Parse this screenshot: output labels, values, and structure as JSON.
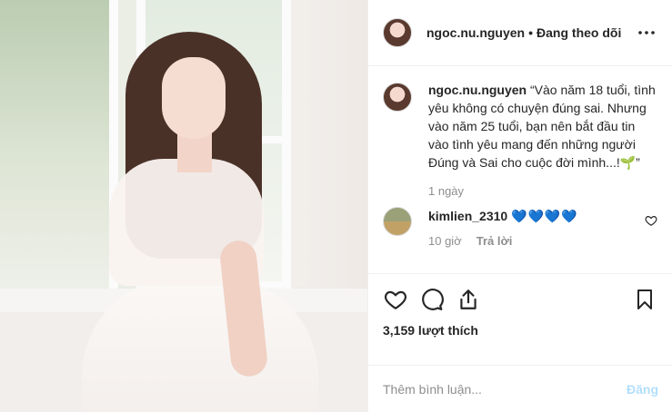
{
  "post": {
    "username": "ngoc.nu.nguyen",
    "separator": "•",
    "follow_status": "Đang theo dõi",
    "more_icon": "more-horizontal-icon",
    "caption": "“Vào năm 18 tuổi, tình yêu không có chuyện đúng sai. Nhưng vào năm 25 tuổi, bạn nên bắt đầu tin vào tình yêu mang đến những người Đúng và Sai cho cuộc đời mình...!🌱”",
    "caption_age": "1 ngày"
  },
  "comments": [
    {
      "username": "kimlien_2310",
      "text": "💙💙💙💙",
      "age": "10 giờ",
      "reply_label": "Trả lời"
    }
  ],
  "actions": {
    "like_icon": "heart-icon",
    "comment_icon": "comment-icon",
    "share_icon": "share-icon",
    "save_icon": "bookmark-icon",
    "likes_text": "3,159 lượt thích"
  },
  "add_comment": {
    "placeholder": "Thêm bình luận...",
    "post_label": "Đăng"
  },
  "colors": {
    "text": "#262626",
    "muted": "#8e8e8e",
    "border": "#efefef",
    "post_disabled": "#b2dffc",
    "heart_blue": "#1877f2"
  }
}
